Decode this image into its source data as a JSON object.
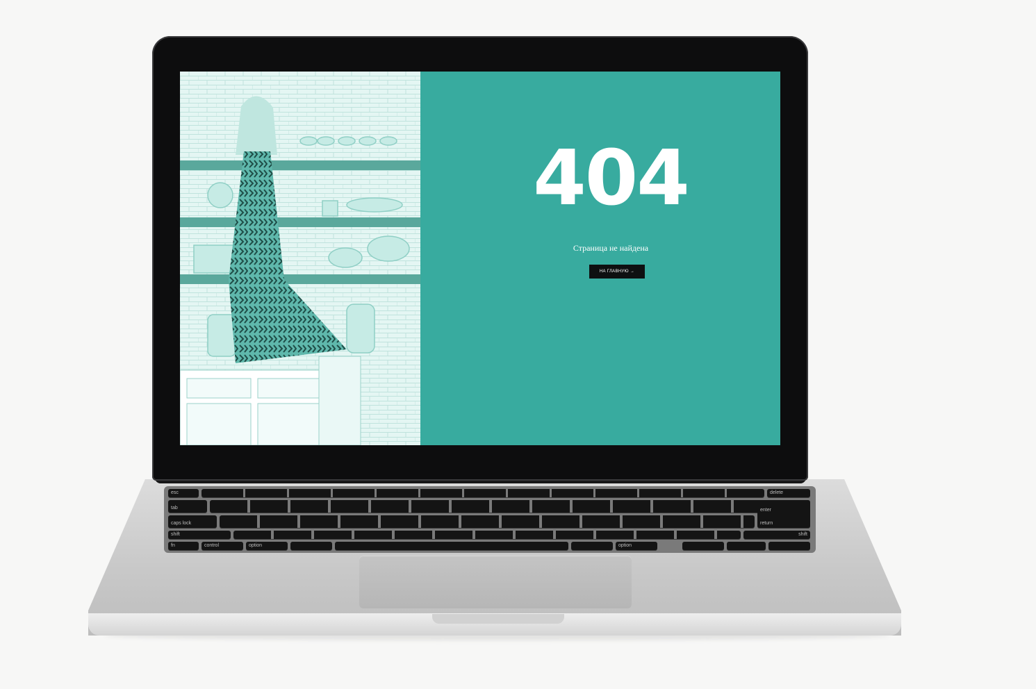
{
  "error_page": {
    "code": "404",
    "message": "Страница не найдена",
    "home_button_label": "НА ГЛАВНУЮ →"
  },
  "colors": {
    "accent": "#38ab9f",
    "button_bg": "#0e1011",
    "photo_tint": "#d6f0ec"
  },
  "keyboard": {
    "labels": [
      "esc",
      "delete",
      "tab",
      "caps lock",
      "return",
      "enter",
      "shift",
      "shift",
      "fn",
      "control",
      "option",
      "option"
    ]
  }
}
